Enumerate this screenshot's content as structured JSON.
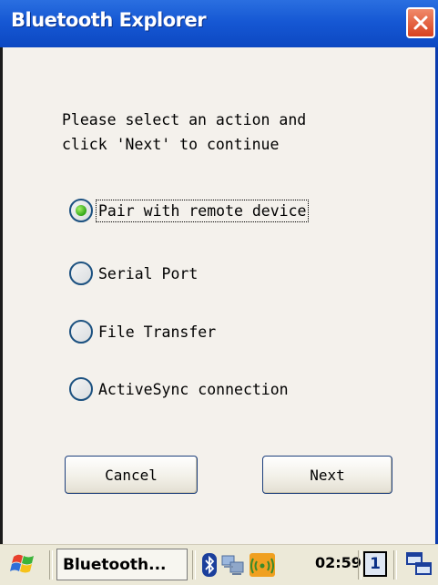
{
  "window": {
    "title": "Bluetooth Explorer"
  },
  "prompt": {
    "line1": "Please select an action and",
    "line2": "click 'Next' to continue"
  },
  "options": [
    {
      "label": "Pair with remote device",
      "selected": true
    },
    {
      "label": "Serial Port",
      "selected": false
    },
    {
      "label": "File Transfer",
      "selected": false
    },
    {
      "label": "ActiveSync connection",
      "selected": false
    }
  ],
  "buttons": {
    "cancel": "Cancel",
    "next": "Next"
  },
  "taskbar": {
    "task_label": "Bluetooth...",
    "clock": "02:59",
    "desktop_number": "1",
    "icons": [
      "start-flag-icon",
      "bluetooth-icon",
      "network-icon",
      "wireless-signal-icon",
      "windows-icon"
    ]
  },
  "colors": {
    "titlebar": "#1658d4",
    "client_bg": "#f4f1ec",
    "radio_selected": "#2fa616"
  }
}
